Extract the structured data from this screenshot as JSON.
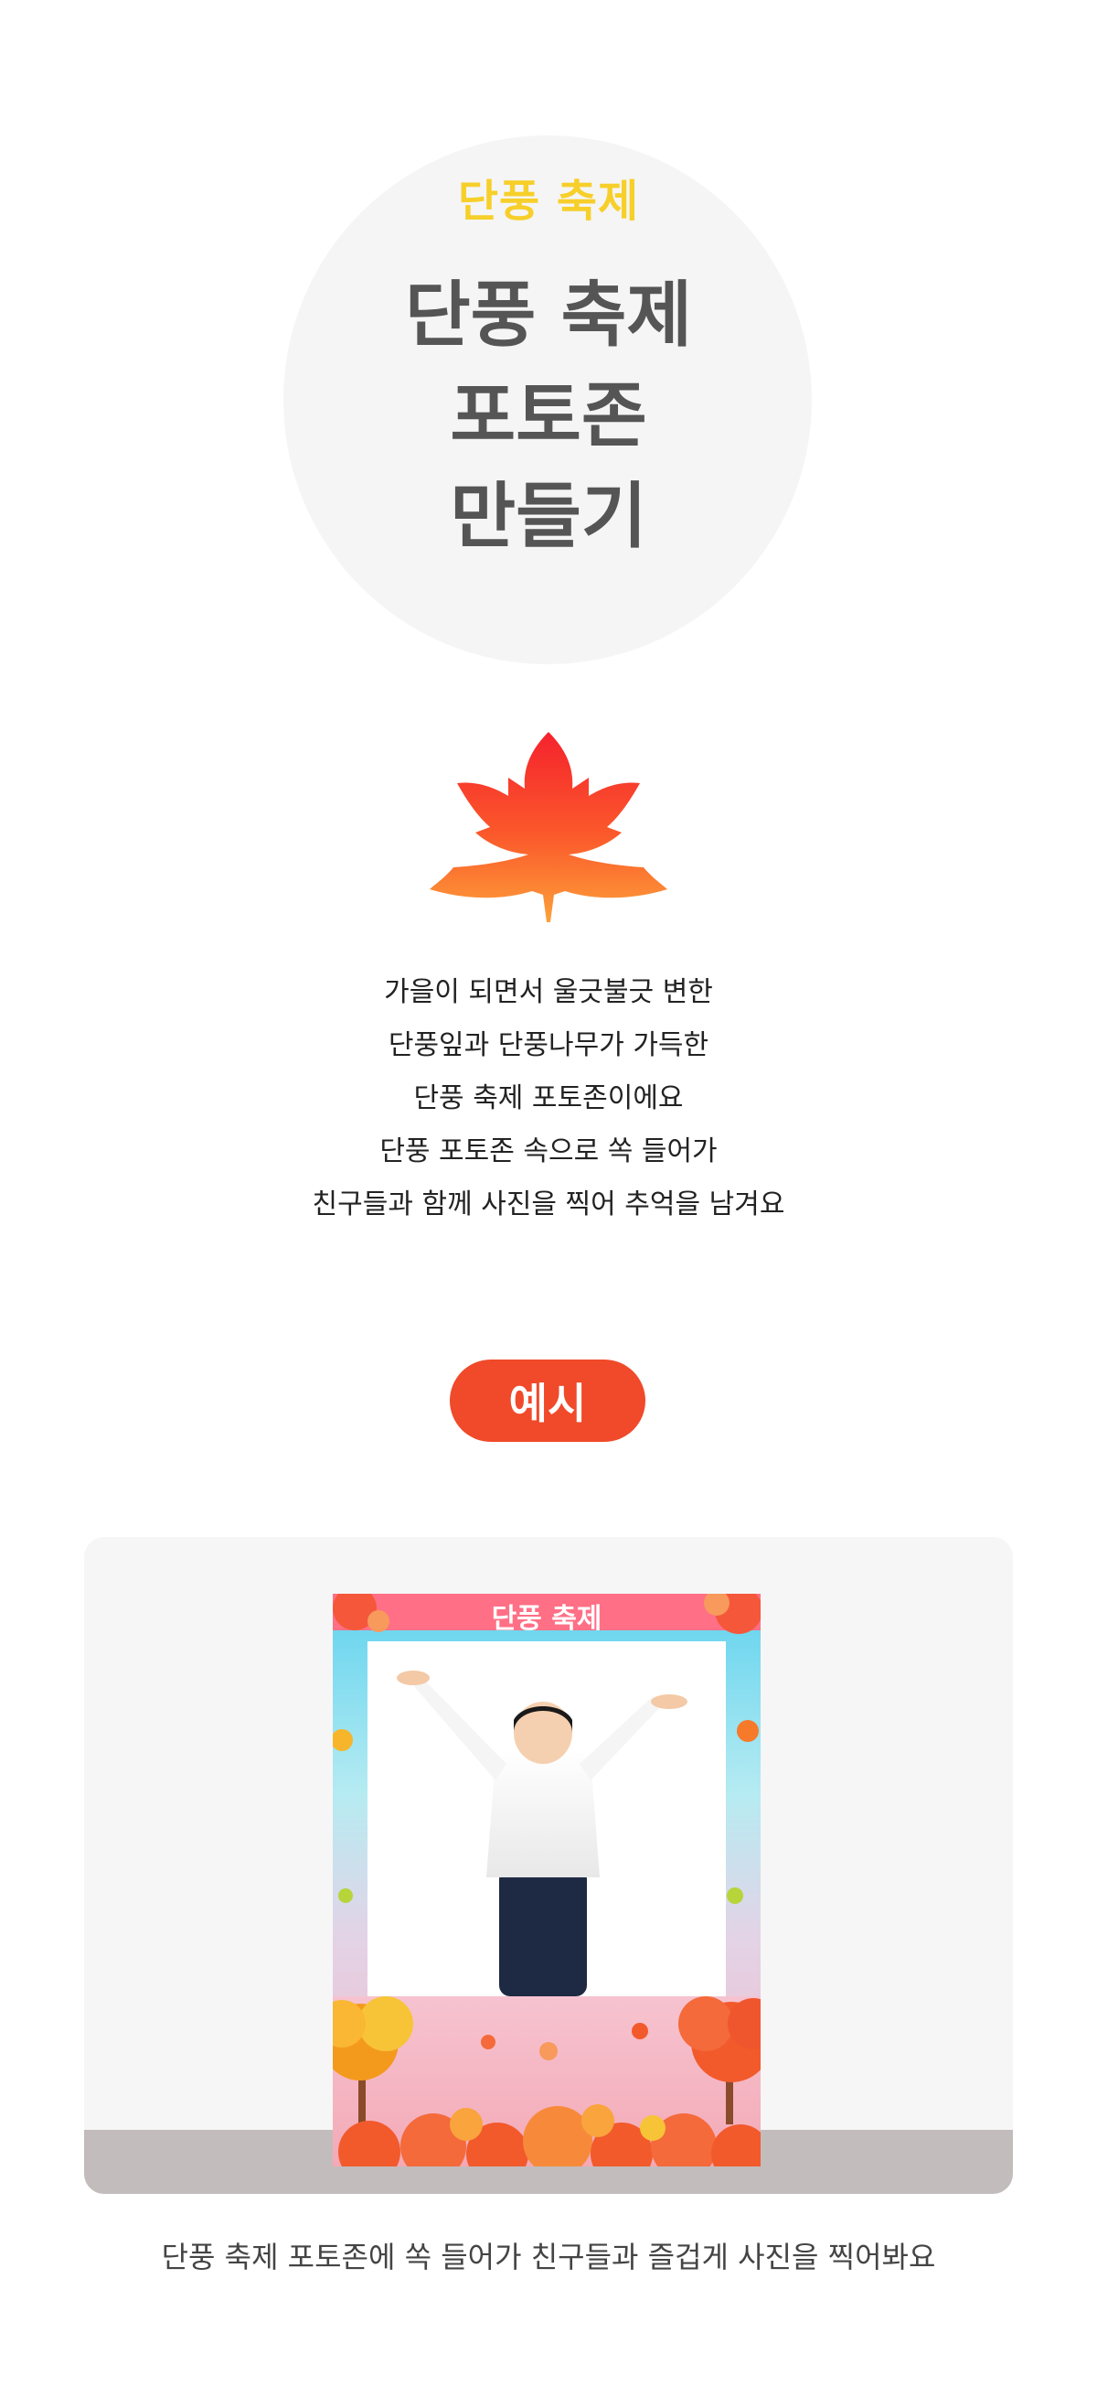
{
  "hero": {
    "kicker": "단풍 축제",
    "title_lines": [
      "단풍 축제",
      "포토존",
      "만들기"
    ]
  },
  "description": {
    "lines": [
      "가을이 되면서 울긋불긋 변한",
      "단풍잎과 단풍나무가 가득한",
      "단풍 축제 포토존이에요",
      "단풍 포토존 속으로 쏙 들어가",
      "친구들과 함께 사진을 찍어 추억을 남겨요"
    ]
  },
  "example": {
    "label": "예시",
    "board_title": "단풍 축제"
  },
  "caption": "단풍 축제 포토존에 쏙 들어가 친구들과 즐겁게 사진을 찍어봐요",
  "colors": {
    "kicker": "#f7cf2a",
    "title": "#555555",
    "accent": "#f04a2a",
    "panel": "#f6f6f6",
    "floor": "#c3bcbc"
  }
}
